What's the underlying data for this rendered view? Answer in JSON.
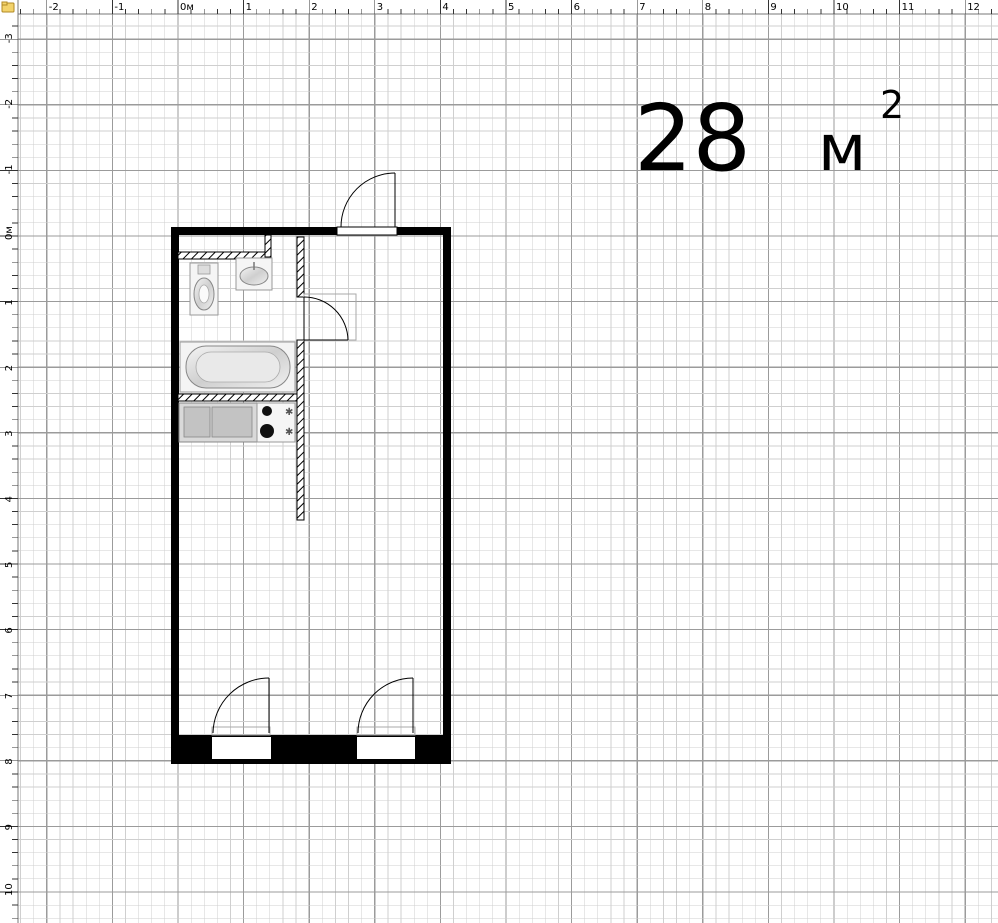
{
  "rulers": {
    "x_labels": [
      "-2",
      "-1",
      "0м",
      "1",
      "2",
      "3",
      "4",
      "5",
      "6",
      "7",
      "8",
      "9",
      "10",
      "11",
      "12"
    ],
    "y_labels": [
      "-3",
      "-2",
      "-1",
      "0м",
      "1",
      "2",
      "3",
      "4",
      "5",
      "6",
      "7",
      "8",
      "9",
      "10"
    ]
  },
  "area": {
    "number": "28",
    "unit": "м",
    "sup": "2"
  },
  "icons": [
    "corner-folder-icon",
    "toilet-icon",
    "sink-icon",
    "bathtub-icon",
    "kitchen-sink-icon",
    "stove-icon",
    "door-icon"
  ],
  "colors": {
    "grid_major": "#9b9b9b",
    "grid_minor": "#cfcfcf",
    "wall": "#000000",
    "ruler_bg": "#ffffff"
  }
}
